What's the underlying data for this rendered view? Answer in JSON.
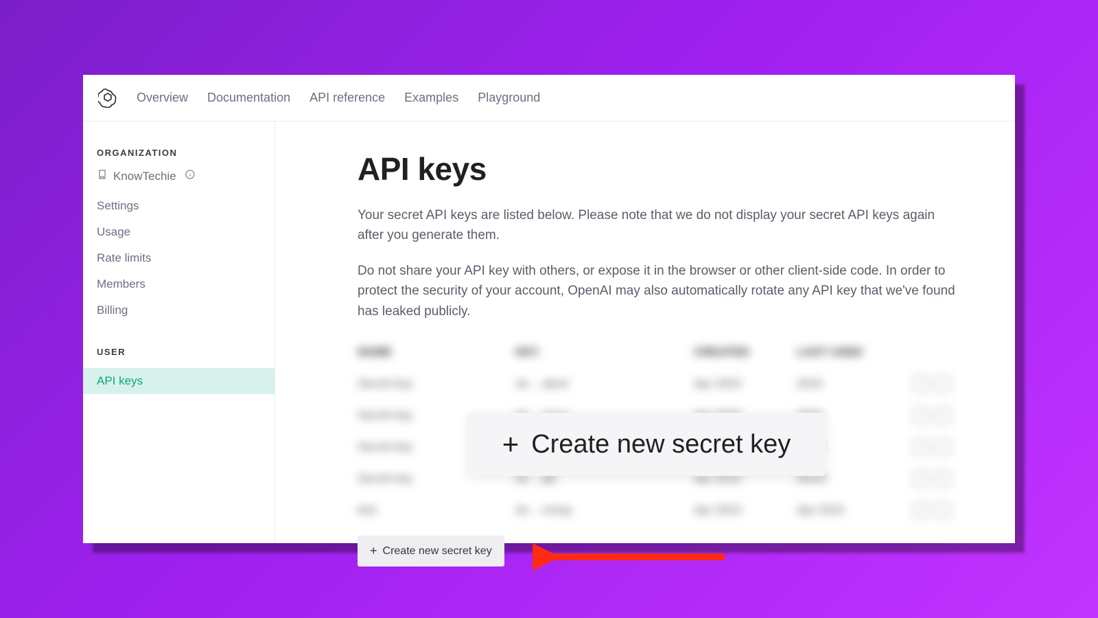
{
  "topnav": {
    "items": [
      "Overview",
      "Documentation",
      "API reference",
      "Examples",
      "Playground"
    ]
  },
  "sidebar": {
    "org_label": "ORGANIZATION",
    "org_name": "KnowTechie",
    "org_items": [
      "Settings",
      "Usage",
      "Rate limits",
      "Members",
      "Billing"
    ],
    "user_label": "USER",
    "user_items": [
      "API keys"
    ],
    "active_user_item": "API keys"
  },
  "main": {
    "title": "API keys",
    "desc1": "Your secret API keys are listed below. Please note that we do not display your secret API keys again after you generate them.",
    "desc2": "Do not share your API key with others, or expose it in the browser or other client-side code. In order to protect the security of your account, OpenAI may also automatically rotate any API key that we've found has leaked publicly.",
    "table_headers": [
      "NAME",
      "KEY",
      "CREATED",
      "LAST USED"
    ],
    "create_label": "Create new secret key",
    "callout_label": "Create new secret key"
  }
}
